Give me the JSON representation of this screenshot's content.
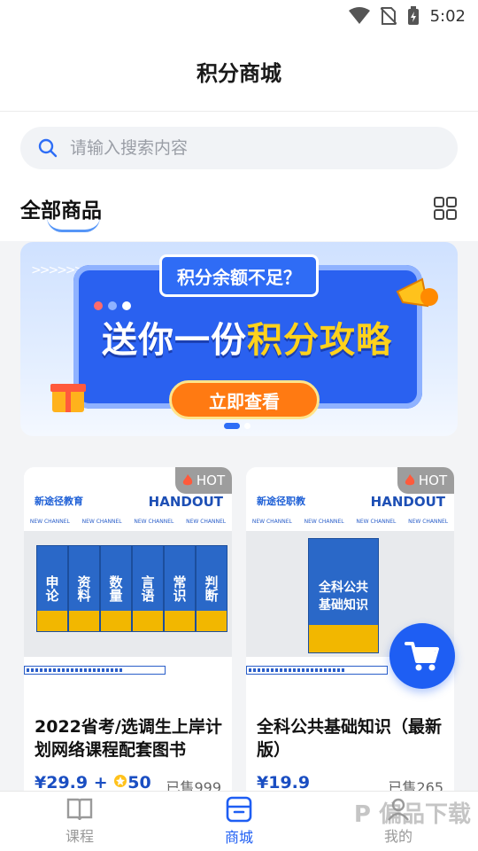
{
  "status_bar": {
    "time": "5:02"
  },
  "header": {
    "title": "积分商城"
  },
  "search": {
    "placeholder": "请输入搜索内容"
  },
  "section": {
    "title": "全部商品"
  },
  "banner": {
    "tag": "积分余额不足？",
    "headline_prefix": "送你一份",
    "headline_highlight": "积分攻略",
    "cta": "立即查看",
    "page_count": 2,
    "active_page": 1
  },
  "products": [
    {
      "badge": "HOT",
      "brand": "新途径教育",
      "handout": "HANDOUT",
      "channel": "NEW CHANNEL",
      "books": [
        "申论",
        "资料",
        "数量",
        "言语",
        "常识",
        "判断"
      ],
      "name": "2022省考/选调生上岸计划网络课程配套图书",
      "price": "¥29.9",
      "points_plus": "+",
      "points": "50",
      "sold": "已售999"
    },
    {
      "badge": "HOT",
      "brand": "新途径职教",
      "handout": "HANDOUT",
      "channel": "NEW CHANNEL",
      "books": [
        "全科公共基础知识"
      ],
      "name": "全科公共基础知识（最新版）",
      "price": "¥19.9",
      "sold": "已售265"
    }
  ],
  "tabs": [
    {
      "label": "课程",
      "icon": "book-icon",
      "active": false
    },
    {
      "label": "商城",
      "icon": "shop-icon",
      "active": true
    },
    {
      "label": "我的",
      "icon": "user-icon",
      "active": false
    }
  ],
  "watermark": "P 偏品下载",
  "colors": {
    "accent": "#1e5ef3",
    "price": "#1a4ec2",
    "hot_badge": "#9d9d9d",
    "cta": "#ff7a12"
  }
}
